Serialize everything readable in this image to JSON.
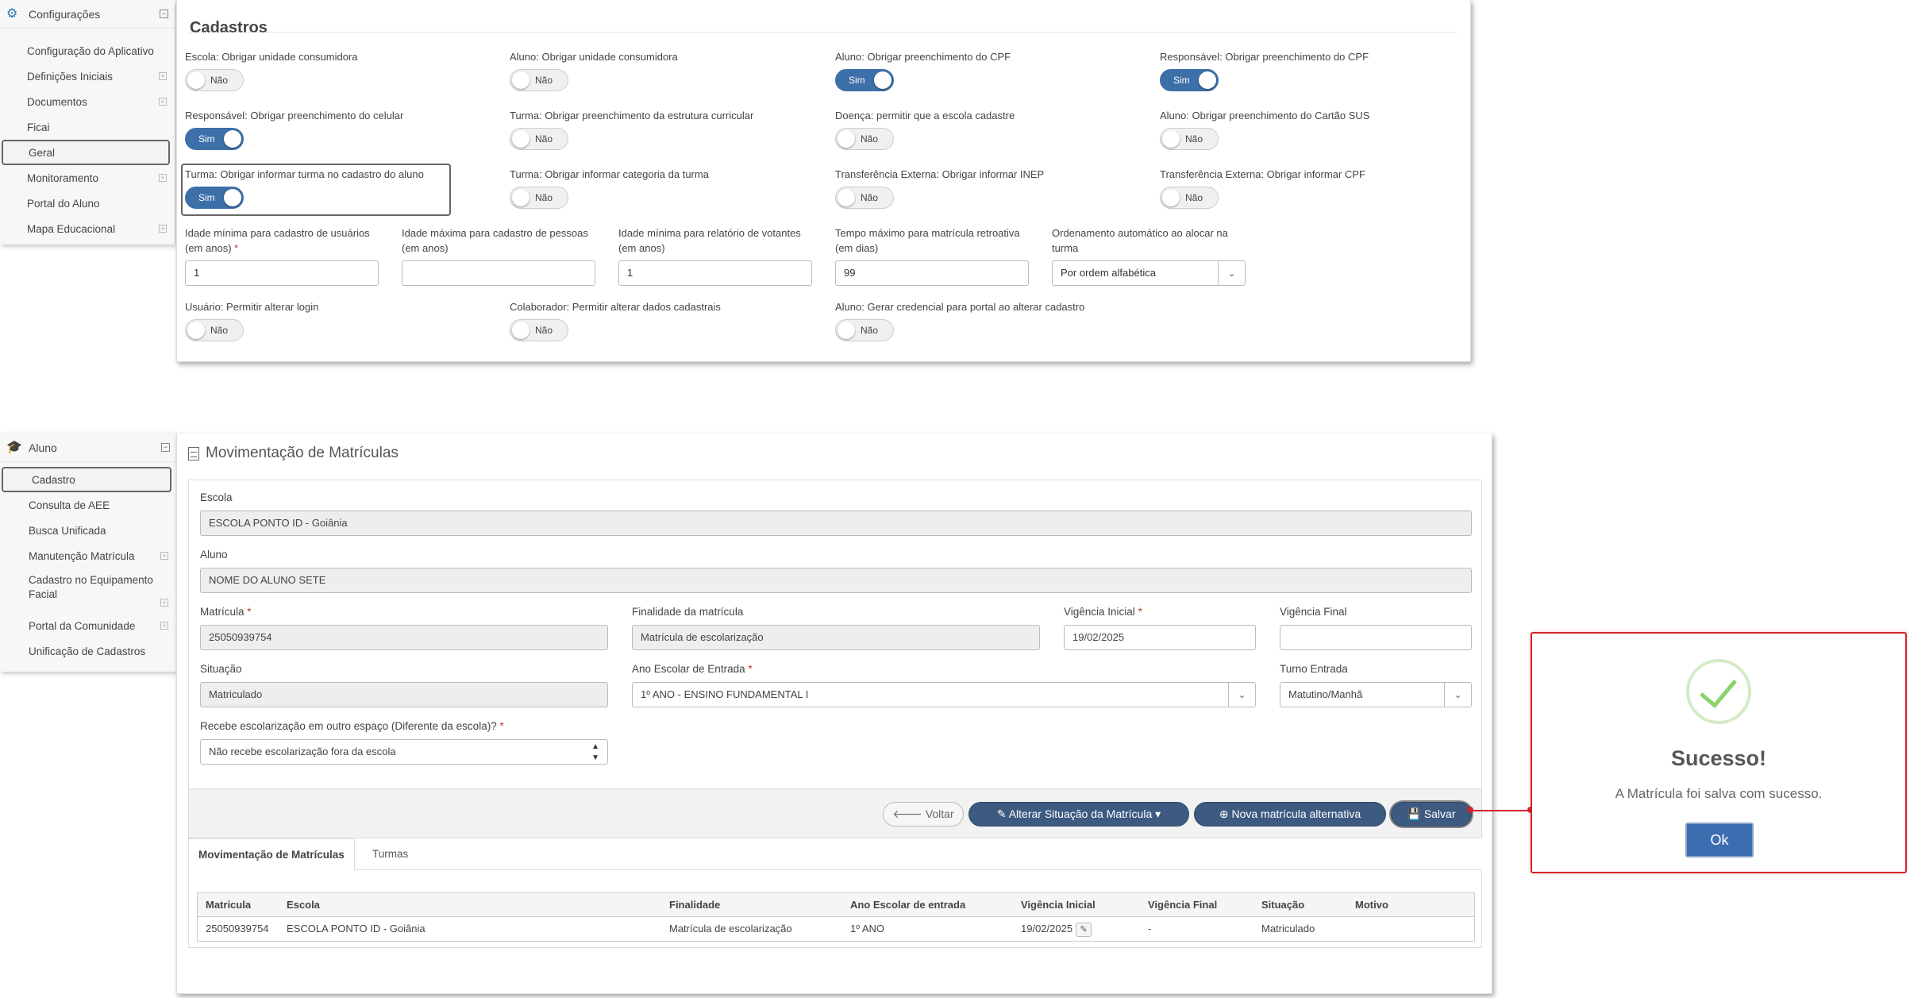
{
  "config_sidebar": {
    "title": "Configurações",
    "items": [
      {
        "label": "Configuração do Aplicativo"
      },
      {
        "label": "Definições Iniciais"
      },
      {
        "label": "Documentos"
      },
      {
        "label": "Ficai"
      },
      {
        "label": "Geral"
      },
      {
        "label": "Monitoramento"
      },
      {
        "label": "Portal do Aluno"
      },
      {
        "label": "Mapa Educacional"
      }
    ]
  },
  "cadastros": {
    "title": "Cadastros",
    "toggles": [
      {
        "label": "Escola: Obrigar unidade consumidora",
        "value": "Não"
      },
      {
        "label": "Aluno: Obrigar unidade consumidora",
        "value": "Não"
      },
      {
        "label": "Aluno: Obrigar preenchimento do CPF",
        "value": "Sim"
      },
      {
        "label": "Responsável: Obrigar preenchimento do CPF",
        "value": "Sim"
      },
      {
        "label": "Responsável: Obrigar preenchimento do celular",
        "value": "Sim"
      },
      {
        "label": "Turma: Obrigar preenchimento da estrutura curricular",
        "value": "Não"
      },
      {
        "label": "Doença: permitir que a escola cadastre",
        "value": "Não"
      },
      {
        "label": "Aluno: Obrigar preenchimento do Cartão SUS",
        "value": "Não"
      },
      {
        "label": "Turma: Obrigar informar turma no cadastro do aluno",
        "value": "Sim"
      },
      {
        "label": "Turma: Obrigar informar categoria da turma",
        "value": "Não"
      },
      {
        "label": "Transferência Externa: Obrigar informar INEP",
        "value": "Não"
      },
      {
        "label": "Transferência Externa: Obrigar informar CPF",
        "value": "Não"
      }
    ],
    "inputs": [
      {
        "label": "Idade mínima para cadastro de usuários (em anos)",
        "value": "1"
      },
      {
        "label": "Idade máxima para cadastro de pessoas (em anos)",
        "value": ""
      },
      {
        "label": "Idade mínima para relatório de votantes (em anos)",
        "value": "1"
      },
      {
        "label": "Tempo máximo para matrícula retroativa (em dias)",
        "value": "99"
      }
    ],
    "ordenamento": {
      "label": "Ordenamento automático ao alocar na turma",
      "value": "Por ordem alfabética"
    },
    "toggles2": [
      {
        "label": "Usuário: Permitir alterar login",
        "value": "Não"
      },
      {
        "label": "Colaborador: Permitir alterar dados cadastrais",
        "value": "Não"
      },
      {
        "label": "Aluno: Gerar credencial para portal ao alterar cadastro",
        "value": "Não"
      }
    ]
  },
  "aluno_sidebar": {
    "title": "Aluno",
    "items": [
      {
        "label": "Cadastro"
      },
      {
        "label": "Consulta de AEE"
      },
      {
        "label": "Busca Unificada"
      },
      {
        "label": "Manutenção Matrícula"
      },
      {
        "label": "Cadastro no Equipamento Facial"
      },
      {
        "label": "Portal da Comunidade"
      },
      {
        "label": "Unificação de Cadastros"
      }
    ]
  },
  "movimentacao": {
    "title": "Movimentação de Matrículas",
    "escola": {
      "label": "Escola",
      "value": "ESCOLA PONTO ID - Goiânia"
    },
    "aluno": {
      "label": "Aluno",
      "value": "NOME DO ALUNO SETE"
    },
    "matricula": {
      "label": "Matrícula",
      "value": "25050939754"
    },
    "finalidade": {
      "label": "Finalidade da matrícula",
      "value": "Matrícula de escolarização"
    },
    "vigencia_inicial": {
      "label": "Vigência Inicial",
      "value": "19/02/2025"
    },
    "vigencia_final": {
      "label": "Vigência Final",
      "value": ""
    },
    "situacao": {
      "label": "Situação",
      "value": "Matriculado"
    },
    "ano_escolar": {
      "label": "Ano Escolar de Entrada",
      "value": "1º ANO - ENSINO FUNDAMENTAL I"
    },
    "turno": {
      "label": "Turno Entrada",
      "value": "Matutino/Manhã"
    },
    "recebe": {
      "label": "Recebe escolarização em outro espaço (Diferente da escola)?",
      "value": "Não recebe escolarização fora da escola"
    },
    "buttons": {
      "voltar": "Voltar",
      "alterar": "Alterar Situação da Matrícula",
      "nova": "Nova matrícula alternativa",
      "salvar": "Salvar"
    },
    "tabs": [
      "Movimentação de Matrículas",
      "Turmas"
    ],
    "table": {
      "headers": [
        "Matricula",
        "Escola",
        "Finalidade",
        "Ano Escolar de entrada",
        "Vigência Inicial",
        "Vigência Final",
        "Situação",
        "Motivo"
      ],
      "rows": [
        [
          "25050939754",
          "ESCOLA PONTO ID - Goiânia",
          "Matrícula de escolarização",
          "1º ANO",
          "19/02/2025",
          "-",
          "Matriculado",
          ""
        ]
      ]
    }
  },
  "modal": {
    "title": "Sucesso!",
    "text": "A Matrícula foi salva com sucesso.",
    "ok": "Ok"
  },
  "icons": {
    "config": "gear-icon",
    "aluno": "graduation-cap-icon",
    "voltar": "arrow-left-icon",
    "alterar": "edit-icon",
    "nova": "plus-circle-icon",
    "salvar": "save-icon",
    "sucesso": "check-icon"
  },
  "colors": {
    "accent": "#3d5a80",
    "toggle_on": "#3d6fa8",
    "highlight_border": "#d0242b",
    "success": "#8cd36a"
  }
}
